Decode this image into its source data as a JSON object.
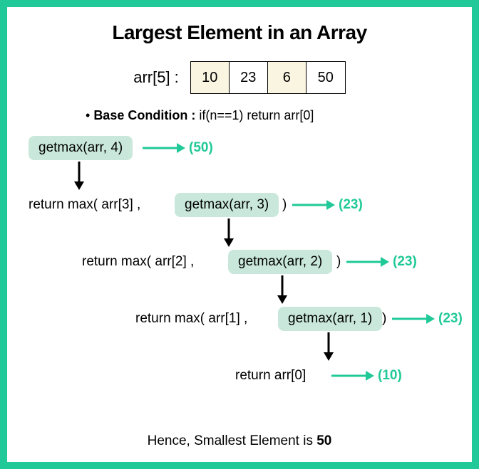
{
  "title": "Largest Element in an Array",
  "array": {
    "label": "arr[5] :",
    "cells": [
      "10",
      "23",
      "6",
      "50"
    ]
  },
  "base_condition": {
    "label": "Base Condition :",
    "code": "if(n==1) return arr[0]"
  },
  "steps": {
    "s1": {
      "call": "getmax(arr, 4)",
      "result": "(50)"
    },
    "s2": {
      "prefix": "return  max( arr[3] ,",
      "call": "getmax(arr, 3)",
      "suffix": ")",
      "result": "(23)"
    },
    "s3": {
      "prefix": "return  max( arr[2] ,",
      "call": "getmax(arr, 2)",
      "suffix": ")",
      "result": "(23)"
    },
    "s4": {
      "prefix": "return  max( arr[1] ,",
      "call": "getmax(arr, 1)",
      "suffix": ")",
      "result": "(23)"
    },
    "s5": {
      "prefix": "return  arr[0]",
      "result": "(10)"
    }
  },
  "conclusion": {
    "text": "Hence, Smallest Element is ",
    "value": "50"
  },
  "colors": {
    "accent": "#20c997",
    "chip": "#c9e8db"
  }
}
